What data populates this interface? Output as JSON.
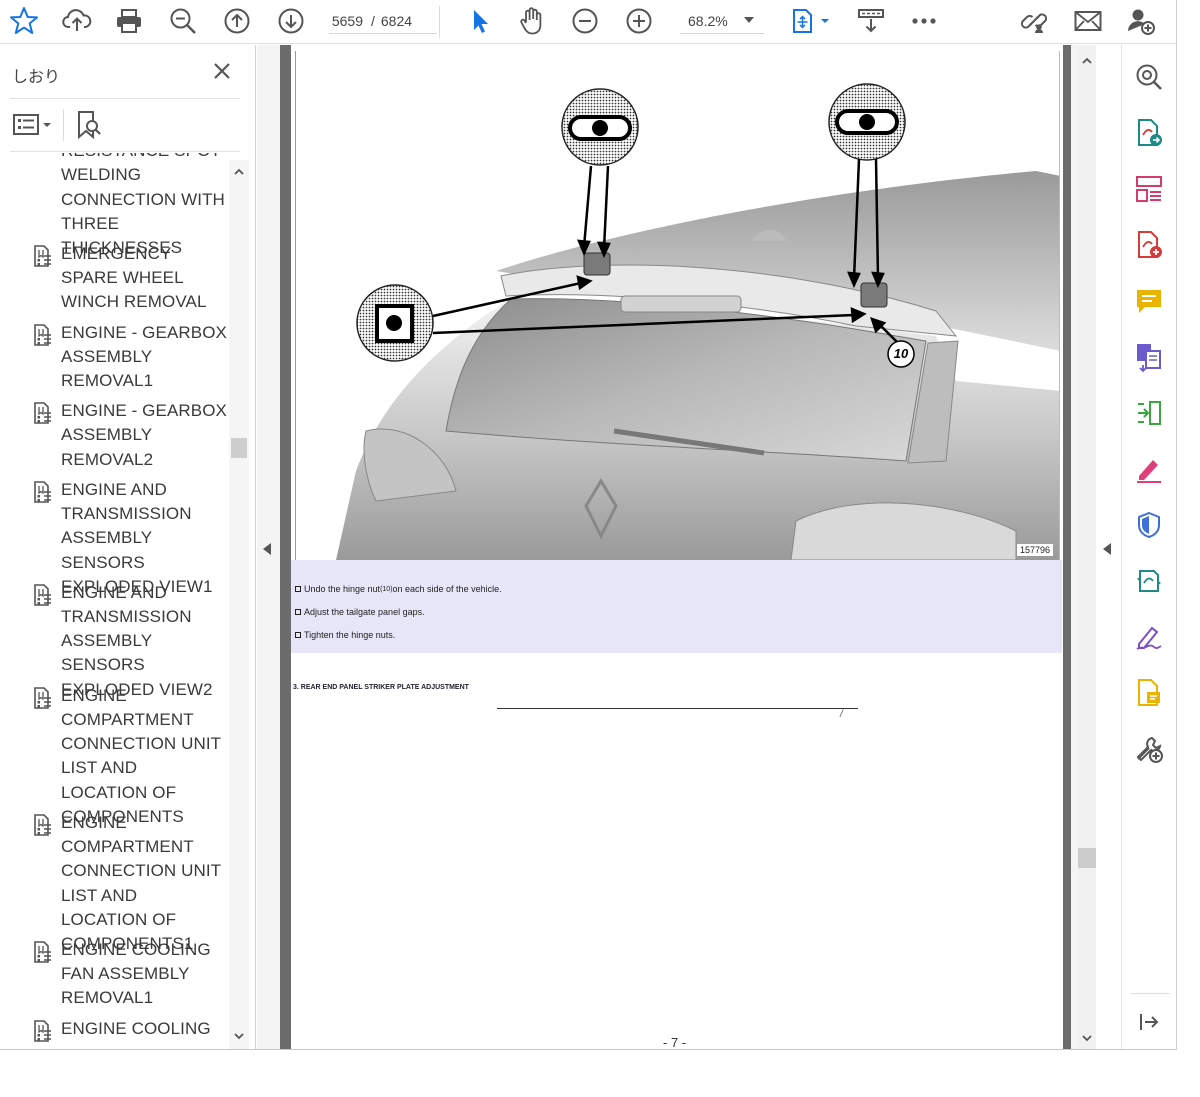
{
  "toolbar": {
    "page_current": "5659",
    "page_sep": "/",
    "page_total": "6824",
    "zoom": "68.2%"
  },
  "sidebar": {
    "title": "しおり",
    "bookmarks": [
      {
        "label": "RESISTANCE SPOT WELDING CONNECTION WITH THREE THICKNESSES",
        "has_icon": false
      },
      {
        "label": "EMERGENCY SPARE WHEEL WINCH REMOVAL",
        "has_icon": true
      },
      {
        "label": "ENGINE - GEARBOX ASSEMBLY REMOVAL1",
        "has_icon": true
      },
      {
        "label": "ENGINE - GEARBOX ASSEMBLY REMOVAL2",
        "has_icon": true
      },
      {
        "label": "ENGINE AND TRANSMISSION ASSEMBLY SENSORS EXPLODED VIEW1",
        "has_icon": true
      },
      {
        "label": "ENGINE AND TRANSMISSION ASSEMBLY SENSORS EXPLODED VIEW2",
        "has_icon": true
      },
      {
        "label": "ENGINE COMPARTMENT CONNECTION UNIT LIST AND LOCATION OF COMPONENTS",
        "has_icon": true
      },
      {
        "label": "ENGINE COMPARTMENT CONNECTION UNIT LIST AND LOCATION OF COMPONENTS1",
        "has_icon": true
      },
      {
        "label": "ENGINE COOLING FAN ASSEMBLY REMOVAL1",
        "has_icon": true
      },
      {
        "label": "ENGINE COOLING",
        "has_icon": true
      }
    ]
  },
  "document": {
    "figure_label": "10",
    "figure_number": "157796",
    "instructions": [
      {
        "before": "Undo the hinge nut",
        "ref": "(10)",
        "after": " on each side of the vehicle."
      },
      {
        "before": "Adjust the tailgate panel gaps.",
        "ref": "",
        "after": ""
      },
      {
        "before": "Tighten the hinge nuts.",
        "ref": "",
        "after": ""
      }
    ],
    "section_title": "3. REAR END PANEL STRIKER PLATE ADJUSTMENT",
    "page_footer": "- 7 -"
  },
  "colors": {
    "accent_blue": "#1473e6",
    "instruction_bg": "#e6e6f8",
    "gutter": "#6c6c6c"
  },
  "icons": {
    "toolbar": [
      "star-icon",
      "cloud-upload-icon",
      "print-icon",
      "zoom-search-icon",
      "page-up-icon",
      "page-down-icon",
      "select-arrow-icon",
      "hand-icon",
      "zoom-out-icon",
      "zoom-in-icon",
      "fit-page-icon",
      "scroll-mode-icon",
      "more-icon",
      "link-share-icon",
      "mail-icon",
      "add-user-icon"
    ],
    "tools": [
      "zoom-icon",
      "export-pdf-icon",
      "organize-pages-icon",
      "create-pdf-icon",
      "comment-icon",
      "combine-files-icon",
      "compress-icon",
      "fill-sign-icon",
      "protect-icon",
      "convert-icon",
      "sign-icon",
      "send-review-icon",
      "more-tools-icon",
      "collapse-panel-icon"
    ]
  }
}
